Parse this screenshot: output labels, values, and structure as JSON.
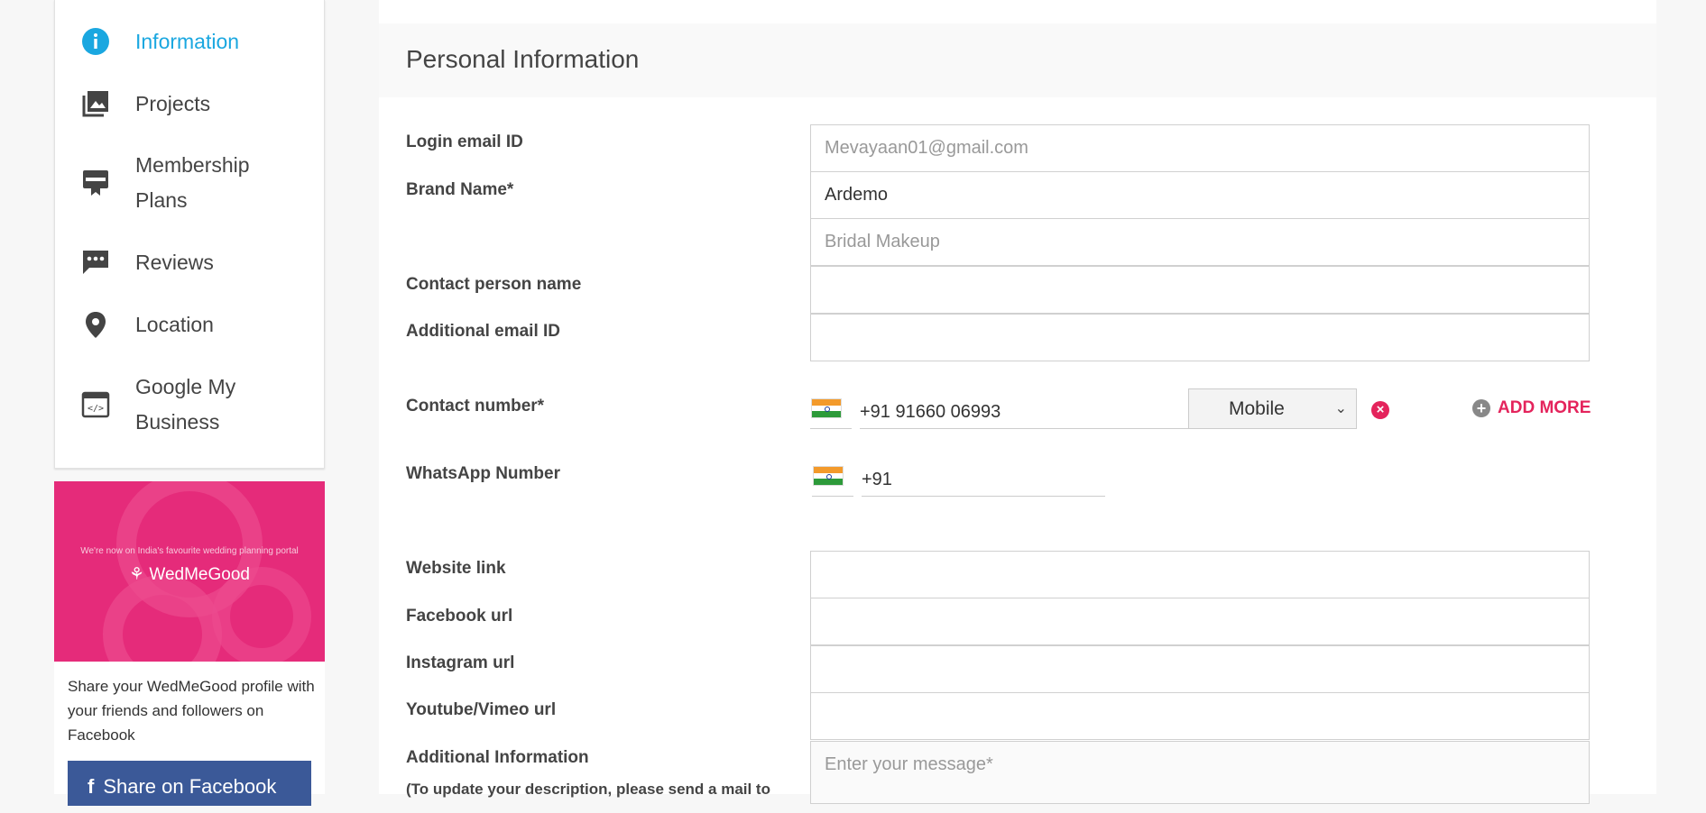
{
  "sidebar": {
    "items": [
      {
        "label": "Information",
        "icon": "info-icon",
        "active": true
      },
      {
        "label": "Projects",
        "icon": "gallery-icon"
      },
      {
        "label": "Membership Plans",
        "icon": "membership-card-icon"
      },
      {
        "label": "Reviews",
        "icon": "review-chat-icon"
      },
      {
        "label": "Location",
        "icon": "location-pin-icon"
      },
      {
        "label": "Google My Business",
        "icon": "code-window-icon"
      }
    ]
  },
  "promo": {
    "tagline": "We're now on India's favourite wedding planning portal",
    "logo_text": "WedMeGood",
    "share_text": "Share your WedMeGood profile with your friends and followers on Facebook",
    "button_label": "Share on Facebook"
  },
  "form": {
    "title": "Personal Information",
    "login_email": {
      "label": "Login email ID",
      "value": "Mevayaan01@gmail.com"
    },
    "brand_name": {
      "label": "Brand Name*",
      "value": "Ardemo"
    },
    "category": {
      "value": "Bridal Makeup"
    },
    "contact_person": {
      "label": "Contact person name",
      "value": ""
    },
    "additional_email": {
      "label": "Additional email ID",
      "value": ""
    },
    "contact_number": {
      "label": "Contact number*",
      "value": "+91 91660 06993",
      "type": "Mobile",
      "add_more": "ADD MORE"
    },
    "whatsapp": {
      "label": "WhatsApp Number",
      "value": "+91"
    },
    "website": {
      "label": "Website link",
      "value": ""
    },
    "facebook": {
      "label": "Facebook url",
      "value": ""
    },
    "instagram": {
      "label": "Instagram url",
      "value": ""
    },
    "youtube": {
      "label": "Youtube/Vimeo url",
      "value": ""
    },
    "additional_info": {
      "label": "Additional Information",
      "note": "(To update your description, please send a mail to",
      "placeholder": "Enter your message*"
    }
  },
  "colors": {
    "accent": "#1aa7e0",
    "brand_pink": "#e52b7a",
    "add_more": "#e4245c",
    "facebook": "#3b5998"
  }
}
